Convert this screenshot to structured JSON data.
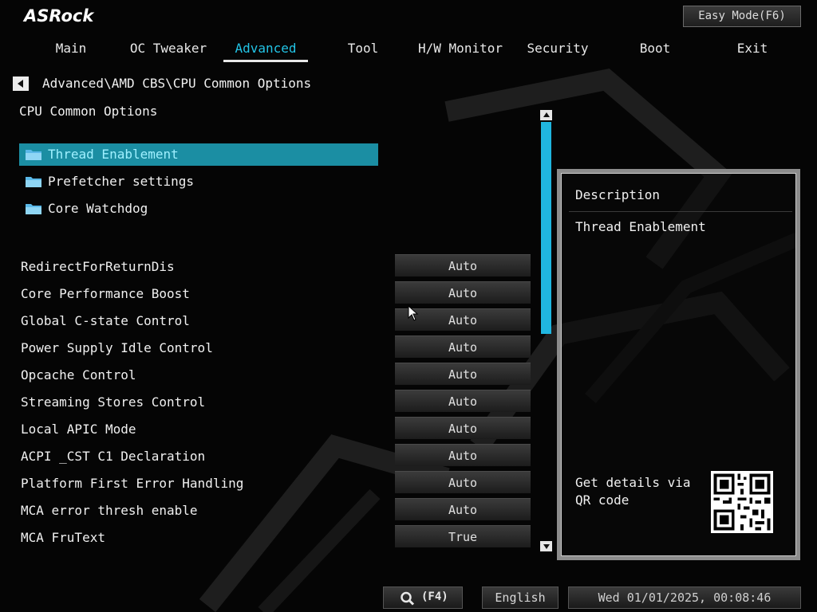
{
  "brand": {
    "logo_text": "ASRock"
  },
  "header": {
    "easy_mode_label": "Easy Mode(F6)"
  },
  "nav": {
    "tabs": [
      {
        "label": "Main"
      },
      {
        "label": "OC Tweaker"
      },
      {
        "label": "Advanced",
        "active": true
      },
      {
        "label": "Tool"
      },
      {
        "label": "H/W Monitor"
      },
      {
        "label": "Security"
      },
      {
        "label": "Boot"
      },
      {
        "label": "Exit"
      }
    ]
  },
  "breadcrumb": {
    "path": "Advanced\\AMD CBS\\CPU Common Options"
  },
  "section": {
    "title": "CPU Common Options"
  },
  "folders": [
    {
      "label": "Thread Enablement",
      "selected": true,
      "icon": "folder-icon"
    },
    {
      "label": "Prefetcher settings",
      "icon": "folder-icon"
    },
    {
      "label": "Core Watchdog",
      "icon": "folder-icon"
    }
  ],
  "settings": [
    {
      "label": "RedirectForReturnDis",
      "value": "Auto"
    },
    {
      "label": "Core Performance Boost",
      "value": "Auto"
    },
    {
      "label": "Global C-state Control",
      "value": "Auto"
    },
    {
      "label": "Power Supply Idle Control",
      "value": "Auto"
    },
    {
      "label": "Opcache Control",
      "value": "Auto"
    },
    {
      "label": "Streaming Stores Control",
      "value": "Auto"
    },
    {
      "label": "Local APIC Mode",
      "value": "Auto"
    },
    {
      "label": "ACPI _CST C1 Declaration",
      "value": "Auto"
    },
    {
      "label": "Platform First Error Handling",
      "value": "Auto"
    },
    {
      "label": "MCA error thresh enable",
      "value": "Auto"
    },
    {
      "label": "MCA FruText",
      "value": "True"
    }
  ],
  "description": {
    "title": "Description",
    "text": "Thread Enablement",
    "qr_text": "Get details via QR code"
  },
  "bottom": {
    "search_key": "(F4)",
    "language": "English",
    "datetime": "Wed 01/01/2025, 00:08:46"
  },
  "colors": {
    "accent": "#22c4e6",
    "selection": "#1b8ea3",
    "scrollbar": "#20b6e0",
    "background": "#050505"
  }
}
